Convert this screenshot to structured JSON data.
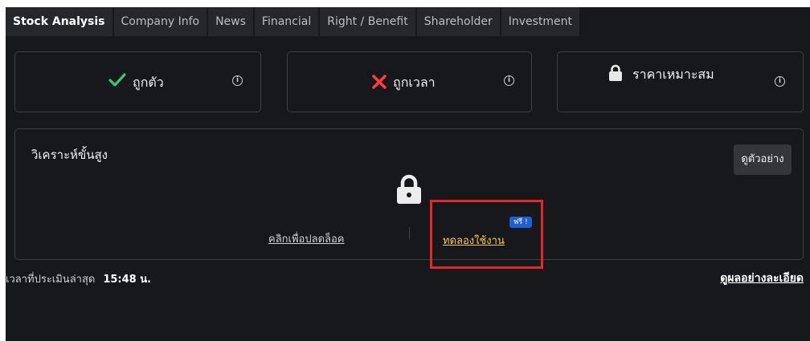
{
  "tabs": [
    {
      "label": "Stock Analysis",
      "active": true
    },
    {
      "label": "Company Info",
      "active": false
    },
    {
      "label": "News",
      "active": false
    },
    {
      "label": "Financial",
      "active": false
    },
    {
      "label": "Right / Benefit",
      "active": false
    },
    {
      "label": "Shareholder",
      "active": false
    },
    {
      "label": "Investment",
      "active": false
    }
  ],
  "cards": {
    "correct_stock": {
      "label": "ถูกตัว",
      "icon": "check-icon",
      "icon_color": "#3ec46d"
    },
    "correct_time": {
      "label": "ถูกเวลา",
      "icon": "cross-icon",
      "icon_color": "#ff3b3b"
    },
    "fair_price": {
      "label": "ราคาเหมาะสม",
      "icon": "lock-icon",
      "icon_color": "#e8e8e8"
    }
  },
  "advanced": {
    "title": "วิเคราะห์ขั้นสูง",
    "example_button": "ดูตัวอย่าง",
    "unlock_link": "คลิกเพื่อปลดล็อค",
    "trial_link": "ทดลองใช้งาน",
    "free_badge": "ฟรี !"
  },
  "footer": {
    "last_evaluated_label": "เวลาที่ประเมินล่าสุด",
    "last_evaluated_time": "15:48 น.",
    "details_link": "ดูผลอย่างละเอียด"
  },
  "colors": {
    "background": "#17181c",
    "tab_bg": "#26272b",
    "border": "#3d3e42",
    "accent_yellow": "#f5c84a",
    "badge_blue": "#1f5fd6",
    "highlight_red": "#e32626"
  }
}
